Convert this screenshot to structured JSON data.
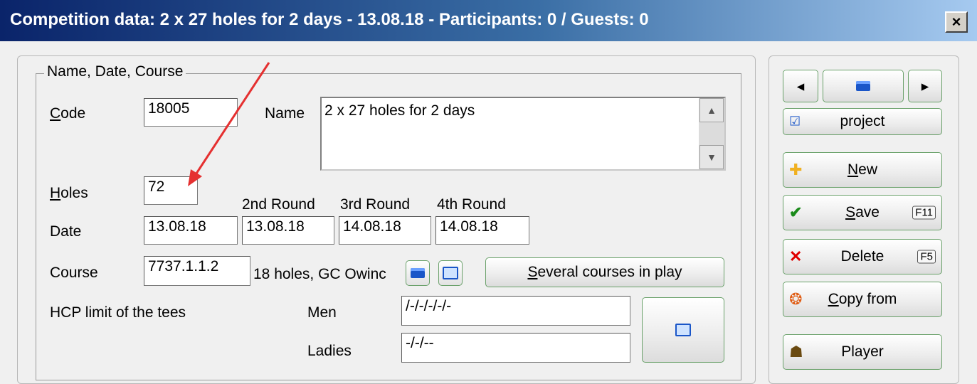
{
  "window": {
    "title": "Competition data: 2 x 27 holes for 2 days - 13.08.18 - Participants: 0 / Guests: 0",
    "close_label": "×"
  },
  "group": {
    "legend": "Name, Date, Course"
  },
  "form": {
    "code_label": "Code",
    "code_value": "18005",
    "name_label": "Name",
    "name_value": "2 x 27 holes for 2 days",
    "holes_label": "Holes",
    "holes_value": "72",
    "round2_label": "2nd Round",
    "round3_label": "3rd Round",
    "round4_label": "4th Round",
    "date_label": "Date",
    "date_values": [
      "13.08.18",
      "13.08.18",
      "14.08.18",
      "14.08.18"
    ],
    "course_label": "Course",
    "course_value": "7737.1.1.2",
    "course_desc": "18 holes, GC Owinc",
    "several_courses_label": "Several courses in play",
    "hcp_label": "HCP limit of the tees",
    "men_label": "Men",
    "men_value": "/-/-/-/-/-",
    "ladies_label": "Ladies",
    "ladies_value": "-/-/--"
  },
  "sidebar": {
    "prev_icon": "◂",
    "next_icon": "▸",
    "project_label": "project",
    "new_label": "New",
    "save_label": "Save",
    "save_key": "F11",
    "delete_label": "Delete",
    "delete_key": "F5",
    "copy_label": "Copy from",
    "player_label": "Player"
  },
  "colors": {
    "arrow": "#e53030",
    "title_start": "#0a246a",
    "title_end": "#a6caf0"
  }
}
